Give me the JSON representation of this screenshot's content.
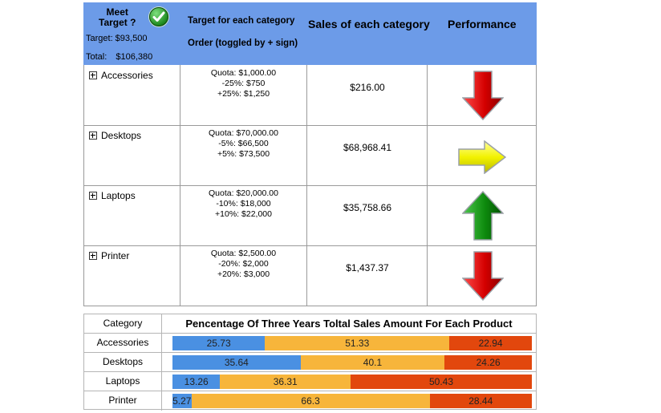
{
  "header": {
    "meet_target_line1": "Meet",
    "meet_target_line2": "Target ?",
    "target_label": "Target: $93,500",
    "total_label": "Total:",
    "total_value": "$106,380",
    "col2_title": "Target for each category",
    "col2_subtitle": "Order (toggled by + sign)",
    "col3_title": "Sales of each category",
    "col4_title": "Performance"
  },
  "rows": [
    {
      "category": "Accessories",
      "quota": "Quota: $1,000.00",
      "low": "-25%: $750",
      "high": "+25%: $1,250",
      "sales": "$216.00",
      "performance": "down"
    },
    {
      "category": "Desktops",
      "quota": "Quota: $70,000.00",
      "low": "-5%: $66,500",
      "high": "+5%: $73,500",
      "sales": "$68,968.41",
      "performance": "right"
    },
    {
      "category": "Laptops",
      "quota": "Quota: $20,000.00",
      "low": "-10%: $18,000",
      "high": "+10%: $22,000",
      "sales": "$35,758.66",
      "performance": "up"
    },
    {
      "category": "Printer",
      "quota": "Quota: $2,500.00",
      "low": "-20%: $2,000",
      "high": "+20%: $3,000",
      "sales": "$1,437.37",
      "performance": "down"
    }
  ],
  "chart_data": {
    "type": "bar",
    "stacked": true,
    "orientation": "horizontal",
    "title": "Pencentage Of Three Years Toltal Sales Amount For Each Product",
    "category_header": "Category",
    "categories": [
      "Accessories",
      "Desktops",
      "Laptops",
      "Printer"
    ],
    "series": [
      {
        "color": "#4a90e2",
        "values": [
          25.73,
          35.64,
          13.26,
          5.27
        ]
      },
      {
        "color": "#f7b53b",
        "values": [
          51.33,
          40.1,
          36.31,
          66.3
        ]
      },
      {
        "color": "#e2470d",
        "values": [
          22.94,
          24.26,
          50.43,
          28.44
        ]
      }
    ],
    "labels": [
      [
        "25.73",
        "51.33",
        "22.94"
      ],
      [
        "35.64",
        "40.1",
        "24.26"
      ],
      [
        "13.26",
        "36.31",
        "50.43"
      ],
      [
        "5.27",
        "66.3",
        "28.44"
      ]
    ]
  },
  "colors": {
    "header_bg": "#6c9be8",
    "arrow_down": "#d40000",
    "arrow_right": "#f2f200",
    "arrow_up": "#0d8a0d"
  }
}
